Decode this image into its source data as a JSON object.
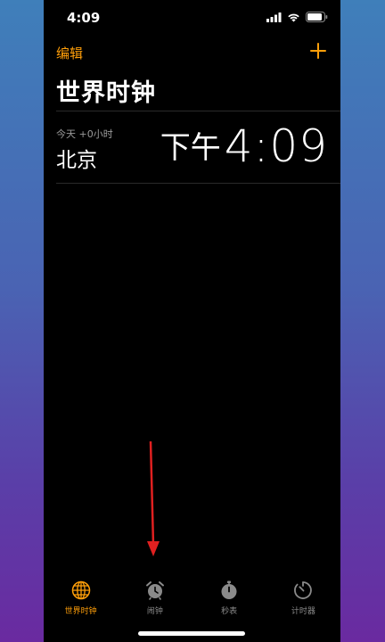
{
  "status_bar": {
    "time": "4:09",
    "icons": [
      "signal-icon",
      "wifi-icon",
      "battery-icon"
    ]
  },
  "nav": {
    "edit_label": "编辑",
    "add_icon": "plus-icon"
  },
  "page": {
    "title": "世界时钟"
  },
  "clocks": [
    {
      "offset": "今天 +0小时",
      "city": "北京",
      "ampm": "下午",
      "time": "4:09"
    }
  ],
  "annotation": {
    "icon": "red-arrow-down-icon",
    "color": "#e02020"
  },
  "tabs": [
    {
      "label": "世界时钟",
      "icon": "globe-icon",
      "active": true
    },
    {
      "label": "闹钟",
      "icon": "alarm-clock-icon",
      "active": false
    },
    {
      "label": "秒表",
      "icon": "stopwatch-icon",
      "active": false
    },
    {
      "label": "计时器",
      "icon": "timer-icon",
      "active": false
    }
  ],
  "colors": {
    "accent": "#ff9f0a",
    "inactive": "#8a8a8a",
    "background": "#000000"
  }
}
